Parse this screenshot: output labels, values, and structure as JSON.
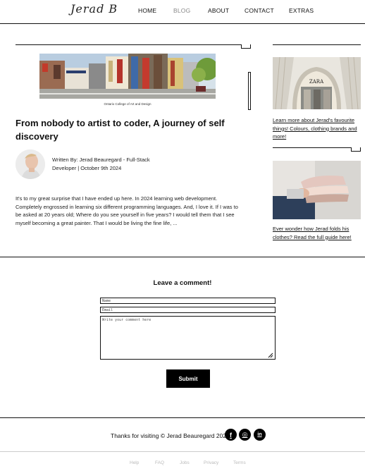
{
  "header": {
    "logo": "Jerad B",
    "nav": [
      {
        "label": "HOME"
      },
      {
        "label": "BLOG",
        "active": true
      },
      {
        "label": "ABOUT"
      },
      {
        "label": "CONTACT"
      },
      {
        "label": "EXTRAS"
      }
    ]
  },
  "article": {
    "image_caption": "Ontario College of Art and Design",
    "title": "From nobody to artist to coder, A journey of self discovery",
    "byline_line1": "Written By: Jerad Beauregard - Full-Stack",
    "byline_line2": "Developer | October 9th 2024",
    "body": "It's to my great surprise that I have ended up here. In 2024 learning web development. Completely engrossed in learning six different programming languages. And, I love it. If I was to be asked at 20 years old; Where do you see yourself in five years? I would tell them that I see myself becoming a great painter. That I would be living the fine life, ..."
  },
  "sidebar": {
    "items": [
      {
        "link": "Learn more about Jerad's favourite things! Colours, clothing brands and more!"
      },
      {
        "link": "Ever wonder how Jerad folds his clothes? Read the full guide here!"
      }
    ],
    "store_sign": "ZARA"
  },
  "comment_form": {
    "title": "Leave a comment!",
    "name_placeholder": "Name",
    "email_placeholder": "Email",
    "comment_placeholder": "Write your comment here",
    "submit_label": "Submit"
  },
  "footer": {
    "text": "Thanks for visiting © Jerad Beauregard 2024",
    "social": [
      {
        "icon": "facebook-icon",
        "glyph": "f"
      },
      {
        "icon": "instagram-icon",
        "glyph": "◎"
      },
      {
        "icon": "linkedin-icon",
        "glyph": "in"
      }
    ],
    "links": [
      {
        "label": "Help"
      },
      {
        "label": "FAQ"
      },
      {
        "label": "Jobs"
      },
      {
        "label": "Privacy"
      },
      {
        "label": "Terms"
      }
    ]
  },
  "colors": {
    "text": "#111111",
    "nav_active": "#888888",
    "button_bg": "#000000",
    "footer_link": "#bbbbbb"
  }
}
